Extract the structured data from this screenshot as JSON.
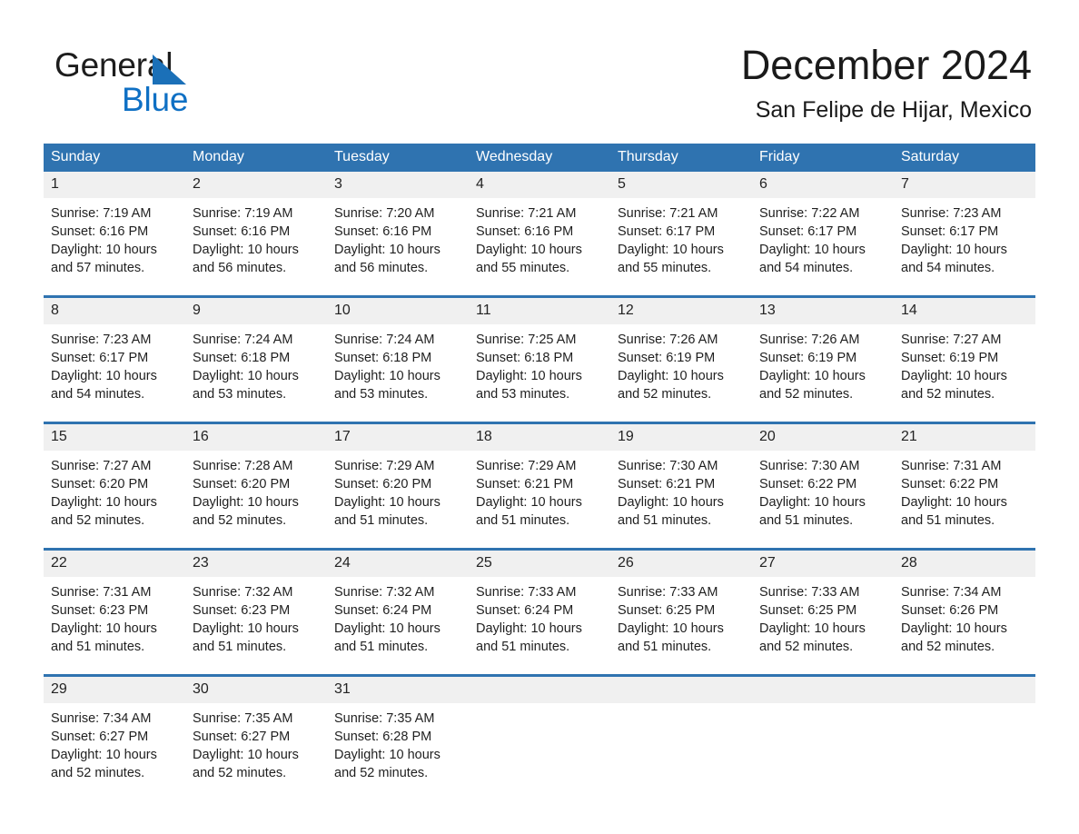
{
  "brand": {
    "name_dark": "General",
    "name_blue": "Blue",
    "triangle_color": "#1b70b8",
    "blue_color": "#0f70c4"
  },
  "header": {
    "month_title": "December 2024",
    "location": "San Felipe de Hijar, Mexico"
  },
  "theme": {
    "header_blue": "#2f73b0",
    "daynum_gray": "#f0f0f0",
    "text": "#1f1f1f"
  },
  "calendar": {
    "weekdays": [
      "Sunday",
      "Monday",
      "Tuesday",
      "Wednesday",
      "Thursday",
      "Friday",
      "Saturday"
    ],
    "weeks": [
      [
        {
          "day": "1",
          "sunrise": "Sunrise: 7:19 AM",
          "sunset": "Sunset: 6:16 PM",
          "daylight_1": "Daylight: 10 hours",
          "daylight_2": "and 57 minutes."
        },
        {
          "day": "2",
          "sunrise": "Sunrise: 7:19 AM",
          "sunset": "Sunset: 6:16 PM",
          "daylight_1": "Daylight: 10 hours",
          "daylight_2": "and 56 minutes."
        },
        {
          "day": "3",
          "sunrise": "Sunrise: 7:20 AM",
          "sunset": "Sunset: 6:16 PM",
          "daylight_1": "Daylight: 10 hours",
          "daylight_2": "and 56 minutes."
        },
        {
          "day": "4",
          "sunrise": "Sunrise: 7:21 AM",
          "sunset": "Sunset: 6:16 PM",
          "daylight_1": "Daylight: 10 hours",
          "daylight_2": "and 55 minutes."
        },
        {
          "day": "5",
          "sunrise": "Sunrise: 7:21 AM",
          "sunset": "Sunset: 6:17 PM",
          "daylight_1": "Daylight: 10 hours",
          "daylight_2": "and 55 minutes."
        },
        {
          "day": "6",
          "sunrise": "Sunrise: 7:22 AM",
          "sunset": "Sunset: 6:17 PM",
          "daylight_1": "Daylight: 10 hours",
          "daylight_2": "and 54 minutes."
        },
        {
          "day": "7",
          "sunrise": "Sunrise: 7:23 AM",
          "sunset": "Sunset: 6:17 PM",
          "daylight_1": "Daylight: 10 hours",
          "daylight_2": "and 54 minutes."
        }
      ],
      [
        {
          "day": "8",
          "sunrise": "Sunrise: 7:23 AM",
          "sunset": "Sunset: 6:17 PM",
          "daylight_1": "Daylight: 10 hours",
          "daylight_2": "and 54 minutes."
        },
        {
          "day": "9",
          "sunrise": "Sunrise: 7:24 AM",
          "sunset": "Sunset: 6:18 PM",
          "daylight_1": "Daylight: 10 hours",
          "daylight_2": "and 53 minutes."
        },
        {
          "day": "10",
          "sunrise": "Sunrise: 7:24 AM",
          "sunset": "Sunset: 6:18 PM",
          "daylight_1": "Daylight: 10 hours",
          "daylight_2": "and 53 minutes."
        },
        {
          "day": "11",
          "sunrise": "Sunrise: 7:25 AM",
          "sunset": "Sunset: 6:18 PM",
          "daylight_1": "Daylight: 10 hours",
          "daylight_2": "and 53 minutes."
        },
        {
          "day": "12",
          "sunrise": "Sunrise: 7:26 AM",
          "sunset": "Sunset: 6:19 PM",
          "daylight_1": "Daylight: 10 hours",
          "daylight_2": "and 52 minutes."
        },
        {
          "day": "13",
          "sunrise": "Sunrise: 7:26 AM",
          "sunset": "Sunset: 6:19 PM",
          "daylight_1": "Daylight: 10 hours",
          "daylight_2": "and 52 minutes."
        },
        {
          "day": "14",
          "sunrise": "Sunrise: 7:27 AM",
          "sunset": "Sunset: 6:19 PM",
          "daylight_1": "Daylight: 10 hours",
          "daylight_2": "and 52 minutes."
        }
      ],
      [
        {
          "day": "15",
          "sunrise": "Sunrise: 7:27 AM",
          "sunset": "Sunset: 6:20 PM",
          "daylight_1": "Daylight: 10 hours",
          "daylight_2": "and 52 minutes."
        },
        {
          "day": "16",
          "sunrise": "Sunrise: 7:28 AM",
          "sunset": "Sunset: 6:20 PM",
          "daylight_1": "Daylight: 10 hours",
          "daylight_2": "and 52 minutes."
        },
        {
          "day": "17",
          "sunrise": "Sunrise: 7:29 AM",
          "sunset": "Sunset: 6:20 PM",
          "daylight_1": "Daylight: 10 hours",
          "daylight_2": "and 51 minutes."
        },
        {
          "day": "18",
          "sunrise": "Sunrise: 7:29 AM",
          "sunset": "Sunset: 6:21 PM",
          "daylight_1": "Daylight: 10 hours",
          "daylight_2": "and 51 minutes."
        },
        {
          "day": "19",
          "sunrise": "Sunrise: 7:30 AM",
          "sunset": "Sunset: 6:21 PM",
          "daylight_1": "Daylight: 10 hours",
          "daylight_2": "and 51 minutes."
        },
        {
          "day": "20",
          "sunrise": "Sunrise: 7:30 AM",
          "sunset": "Sunset: 6:22 PM",
          "daylight_1": "Daylight: 10 hours",
          "daylight_2": "and 51 minutes."
        },
        {
          "day": "21",
          "sunrise": "Sunrise: 7:31 AM",
          "sunset": "Sunset: 6:22 PM",
          "daylight_1": "Daylight: 10 hours",
          "daylight_2": "and 51 minutes."
        }
      ],
      [
        {
          "day": "22",
          "sunrise": "Sunrise: 7:31 AM",
          "sunset": "Sunset: 6:23 PM",
          "daylight_1": "Daylight: 10 hours",
          "daylight_2": "and 51 minutes."
        },
        {
          "day": "23",
          "sunrise": "Sunrise: 7:32 AM",
          "sunset": "Sunset: 6:23 PM",
          "daylight_1": "Daylight: 10 hours",
          "daylight_2": "and 51 minutes."
        },
        {
          "day": "24",
          "sunrise": "Sunrise: 7:32 AM",
          "sunset": "Sunset: 6:24 PM",
          "daylight_1": "Daylight: 10 hours",
          "daylight_2": "and 51 minutes."
        },
        {
          "day": "25",
          "sunrise": "Sunrise: 7:33 AM",
          "sunset": "Sunset: 6:24 PM",
          "daylight_1": "Daylight: 10 hours",
          "daylight_2": "and 51 minutes."
        },
        {
          "day": "26",
          "sunrise": "Sunrise: 7:33 AM",
          "sunset": "Sunset: 6:25 PM",
          "daylight_1": "Daylight: 10 hours",
          "daylight_2": "and 51 minutes."
        },
        {
          "day": "27",
          "sunrise": "Sunrise: 7:33 AM",
          "sunset": "Sunset: 6:25 PM",
          "daylight_1": "Daylight: 10 hours",
          "daylight_2": "and 52 minutes."
        },
        {
          "day": "28",
          "sunrise": "Sunrise: 7:34 AM",
          "sunset": "Sunset: 6:26 PM",
          "daylight_1": "Daylight: 10 hours",
          "daylight_2": "and 52 minutes."
        }
      ],
      [
        {
          "day": "29",
          "sunrise": "Sunrise: 7:34 AM",
          "sunset": "Sunset: 6:27 PM",
          "daylight_1": "Daylight: 10 hours",
          "daylight_2": "and 52 minutes."
        },
        {
          "day": "30",
          "sunrise": "Sunrise: 7:35 AM",
          "sunset": "Sunset: 6:27 PM",
          "daylight_1": "Daylight: 10 hours",
          "daylight_2": "and 52 minutes."
        },
        {
          "day": "31",
          "sunrise": "Sunrise: 7:35 AM",
          "sunset": "Sunset: 6:28 PM",
          "daylight_1": "Daylight: 10 hours",
          "daylight_2": "and 52 minutes."
        },
        {
          "day": "",
          "sunrise": "",
          "sunset": "",
          "daylight_1": "",
          "daylight_2": ""
        },
        {
          "day": "",
          "sunrise": "",
          "sunset": "",
          "daylight_1": "",
          "daylight_2": ""
        },
        {
          "day": "",
          "sunrise": "",
          "sunset": "",
          "daylight_1": "",
          "daylight_2": ""
        },
        {
          "day": "",
          "sunrise": "",
          "sunset": "",
          "daylight_1": "",
          "daylight_2": ""
        }
      ]
    ]
  }
}
